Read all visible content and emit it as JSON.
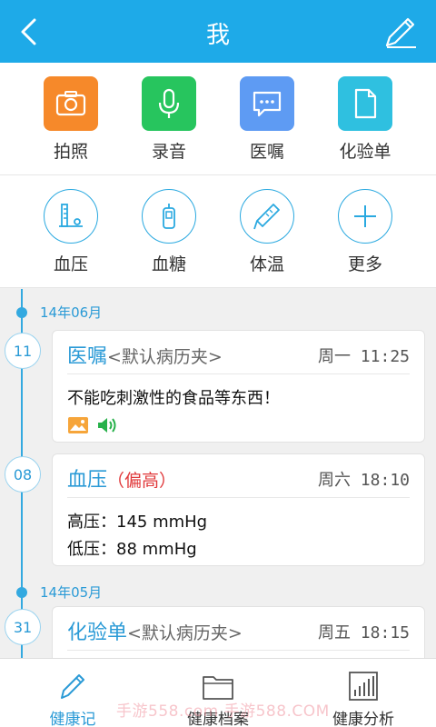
{
  "header": {
    "title": "我",
    "bg_color": "#1eaae8",
    "back_icon": "chevron-left-icon",
    "edit_icon": "pencil-icon"
  },
  "record_actions": [
    {
      "label": "拍照",
      "icon": "camera-icon",
      "color": "#f6892a"
    },
    {
      "label": "录音",
      "icon": "microphone-icon",
      "color": "#27c55e"
    },
    {
      "label": "医嘱",
      "icon": "chat-bubble-icon",
      "color": "#5e9bf3"
    },
    {
      "label": "化验单",
      "icon": "document-icon",
      "color": "#2fc0e0"
    }
  ],
  "measure_actions": [
    {
      "label": "血压",
      "icon": "blood-pressure-icon"
    },
    {
      "label": "血糖",
      "icon": "glucose-meter-icon"
    },
    {
      "label": "体温",
      "icon": "thermometer-icon"
    },
    {
      "label": "更多",
      "icon": "plus-icon"
    }
  ],
  "timeline": {
    "groups": [
      {
        "month": "14年06月",
        "entries": [
          {
            "day": "11",
            "type": "医嘱",
            "folder": "<默认病历夹>",
            "time": "周一 11:25",
            "lines": [
              "不能吃刺激性的食品等东西！"
            ],
            "attachments": [
              "image-icon",
              "speaker-icon"
            ]
          },
          {
            "day": "08",
            "type": "血压",
            "flag": "（偏高）",
            "time": "周六 18:10",
            "lines": [
              "高压：145 mmHg",
              "低压：88 mmHg"
            ]
          }
        ]
      },
      {
        "month": "14年05月",
        "entries": [
          {
            "day": "31",
            "type": "化验单",
            "folder": "<默认病历夹>",
            "time": "周五 18:15"
          }
        ]
      }
    ]
  },
  "bottom_tabs": [
    {
      "label": "健康记",
      "icon": "pencil-icon",
      "active": true
    },
    {
      "label": "健康档案",
      "icon": "folder-icon",
      "active": false
    },
    {
      "label": "健康分析",
      "icon": "bar-chart-icon",
      "active": false
    }
  ],
  "watermark": "手游558.com 手游588.COM",
  "colors": {
    "accent": "#2a9ad6",
    "alert": "#e0383a"
  }
}
